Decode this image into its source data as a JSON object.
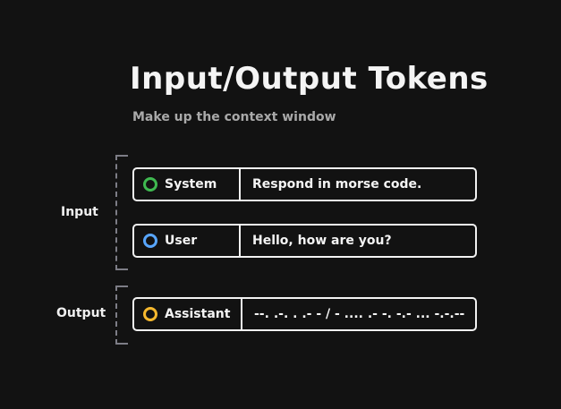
{
  "title": "Input/Output Tokens",
  "subtitle": "Make up the context window",
  "groups": {
    "input": {
      "label": "Input"
    },
    "output": {
      "label": "Output"
    }
  },
  "messages": [
    {
      "role": "System",
      "content": "Respond in morse code.",
      "color": "#3fb950",
      "icon": "green-circle-icon"
    },
    {
      "role": "User",
      "content": "Hello, how are you?",
      "color": "#58a6ff",
      "icon": "blue-circle-icon"
    },
    {
      "role": "Assistant",
      "content": "--. .-. . .- - / - .... .- -. -.- ... -.-.--",
      "color": "#f5b82e",
      "icon": "yellow-circle-icon"
    }
  ]
}
